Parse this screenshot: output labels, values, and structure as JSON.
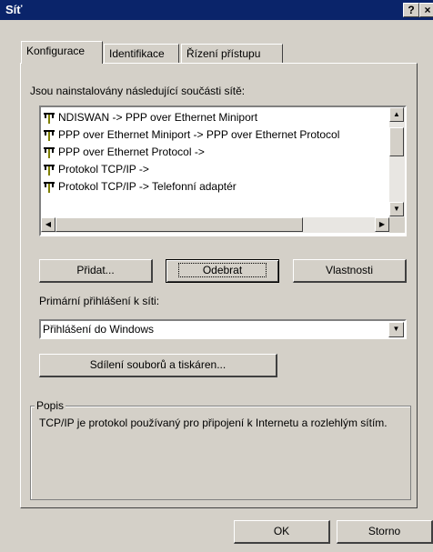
{
  "window": {
    "title": "Síť",
    "help_btn": "?",
    "close_btn": "×"
  },
  "tabs": [
    {
      "label": "Konfigurace"
    },
    {
      "label": "Identifikace"
    },
    {
      "label": "Řízení přístupu"
    }
  ],
  "components_label": "Jsou nainstalovány následující součásti sítě:",
  "components": [
    {
      "label": "NDISWAN -> PPP over Ethernet Miniport",
      "icon": "network-protocol-icon"
    },
    {
      "label": "PPP over Ethernet Miniport -> PPP over Ethernet Protocol",
      "icon": "network-protocol-icon"
    },
    {
      "label": "PPP over Ethernet Protocol ->",
      "icon": "network-protocol-icon"
    },
    {
      "label": "Protokol TCP/IP ->",
      "icon": "network-protocol-icon"
    },
    {
      "label": "Protokol TCP/IP -> Telefonní adaptér",
      "icon": "network-protocol-icon"
    }
  ],
  "buttons": {
    "add": "Přidat...",
    "remove": "Odebrat",
    "properties": "Vlastnosti"
  },
  "primary_logon_label": "Primární přihlášení k síti:",
  "primary_logon_value": "Přihlášení do Windows",
  "sharing_button": "Sdílení souborů a tiskáren...",
  "description": {
    "legend": "Popis",
    "text": "TCP/IP je protokol používaný pro připojení k Internetu a rozlehlým sítím."
  },
  "footer": {
    "ok": "OK",
    "cancel": "Storno"
  },
  "colors": {
    "titlebar": "#0a246a",
    "face": "#d4d0c8"
  }
}
